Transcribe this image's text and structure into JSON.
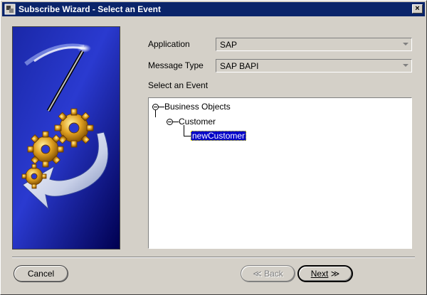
{
  "window": {
    "title": "Subscribe Wizard  - Select an Event",
    "close_glyph": "×"
  },
  "form": {
    "application_label": "Application",
    "application_value": "SAP",
    "message_type_label": "Message Type",
    "message_type_value": "SAP BAPI",
    "event_label": "Select an Event"
  },
  "tree": {
    "root": "Business Objects",
    "child": "Customer",
    "leaf": "newCustomer"
  },
  "buttons": {
    "cancel": "Cancel",
    "back": "Back",
    "back_glyph": "≪",
    "next": "Next",
    "next_glyph": "≫"
  },
  "colors": {
    "titlebar": "#0a246a",
    "selection": "#0000c8",
    "banner_dark": "#000050",
    "banner_light": "#2a3ad0"
  }
}
